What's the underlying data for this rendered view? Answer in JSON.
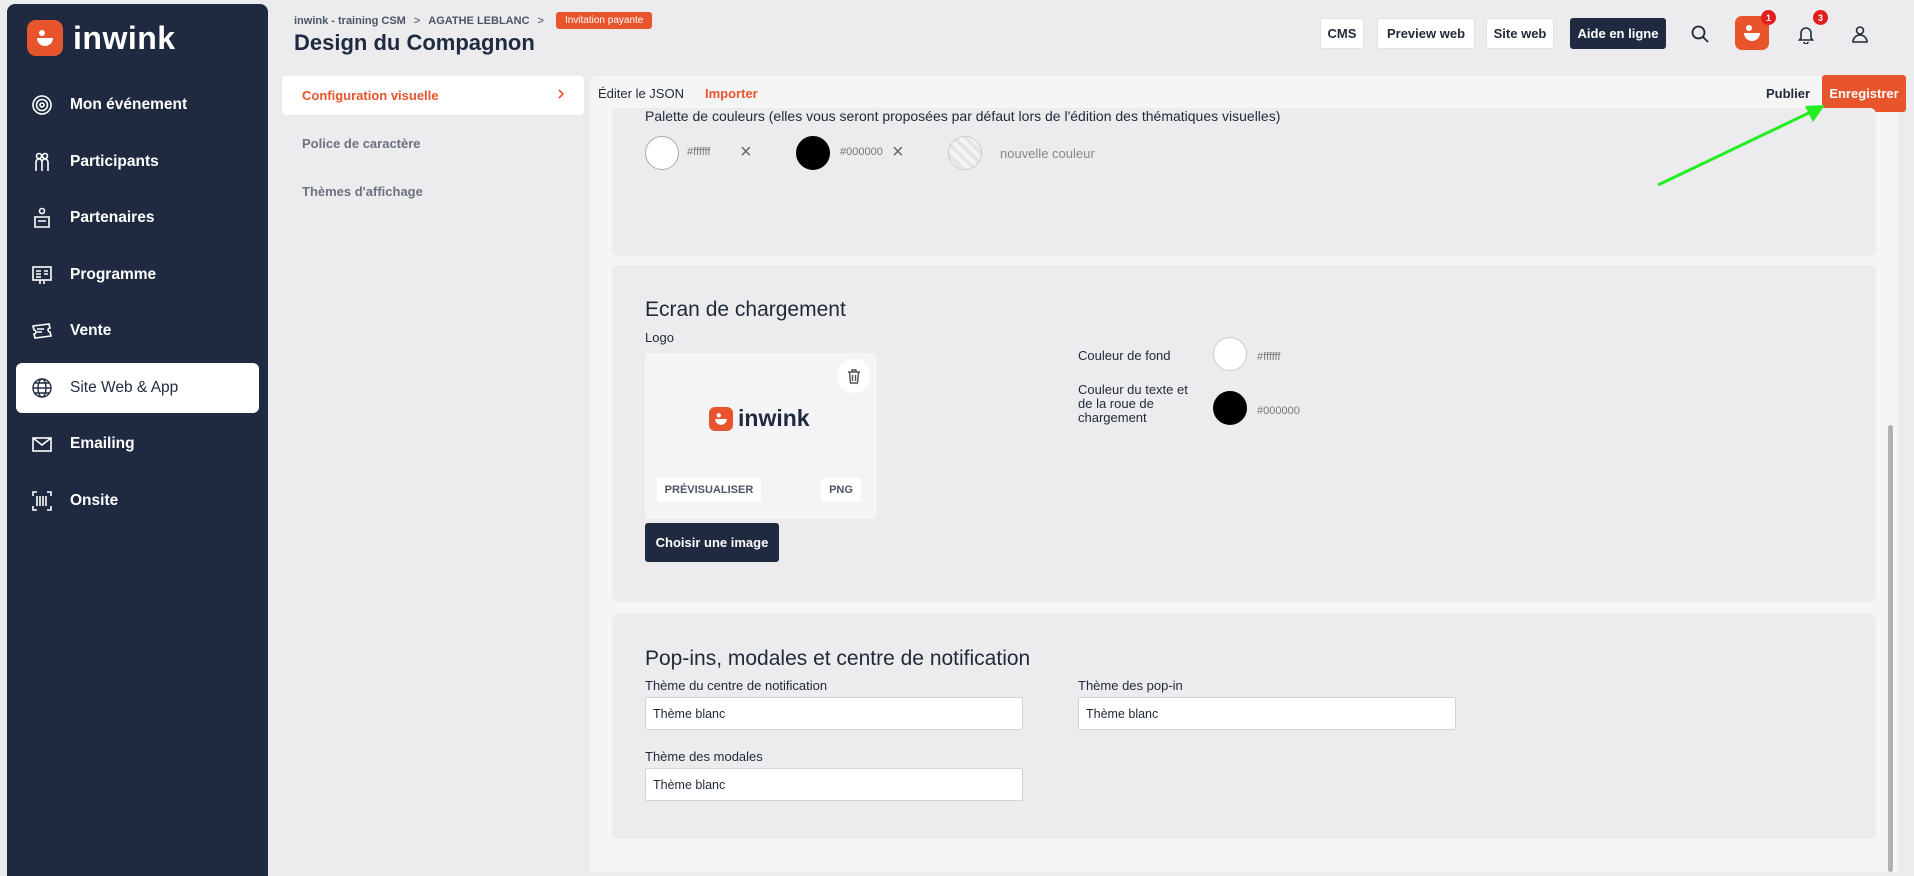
{
  "sidebar": {
    "brand": "inwink",
    "items": [
      {
        "label": "Mon événement",
        "icon": "target-icon"
      },
      {
        "label": "Participants",
        "icon": "people-icon"
      },
      {
        "label": "Partenaires",
        "icon": "booth-icon"
      },
      {
        "label": "Programme",
        "icon": "presentation-icon"
      },
      {
        "label": "Vente",
        "icon": "ticket-icon"
      },
      {
        "label": "Site Web & App",
        "icon": "globe-icon"
      },
      {
        "label": "Emailing",
        "icon": "mail-icon"
      },
      {
        "label": "Onsite",
        "icon": "barcode-icon"
      }
    ],
    "active_index": 5
  },
  "header": {
    "breadcrumb": [
      "inwink - training CSM",
      "AGATHE LEBLANC"
    ],
    "badge": "Invitation payante",
    "title": "Design du Compagnon",
    "buttons": {
      "cms": "CMS",
      "preview": "Preview web",
      "site": "Site web",
      "help": "Aide en ligne"
    },
    "app_badge_count": "1",
    "notification_count": "3"
  },
  "config_menu": {
    "items": [
      "Configuration visuelle",
      "Police de caractère",
      "Thèmes d'affichage"
    ],
    "active_index": 0
  },
  "toolbar": {
    "edit_json": "Éditer le JSON",
    "import": "Importer",
    "publish": "Publier",
    "save": "Enregistrer"
  },
  "palette": {
    "label": "Palette de couleurs (elles vous seront proposées par défaut lors de l'édition des thématiques visuelles)",
    "colors": [
      "#ffffff",
      "#000000"
    ],
    "new_color": "nouvelle couleur"
  },
  "loading_screen": {
    "title": "Ecran de chargement",
    "logo_label": "Logo",
    "logo_word": "inwink",
    "preview_chip": "PRÉVISUALISER",
    "format_chip": "PNG",
    "choose_image": "Choisir une image",
    "background_label": "Couleur de fond",
    "background_color": "#ffffff",
    "text_color_label": "Couleur du texte et de la roue de chargement",
    "text_color": "#000000"
  },
  "popins": {
    "title": "Pop-ins, modales et centre de notification",
    "notification_center_label": "Thème du centre de notification",
    "notification_center_value": "Thème blanc",
    "popin_label": "Thème des pop-in",
    "popin_value": "Thème blanc",
    "modal_label": "Thème des modales",
    "modal_value": "Thème blanc"
  },
  "colors": {
    "accent": "#e8542c",
    "navy": "#1f2a40",
    "annotation_arrow": "#22ee22"
  }
}
